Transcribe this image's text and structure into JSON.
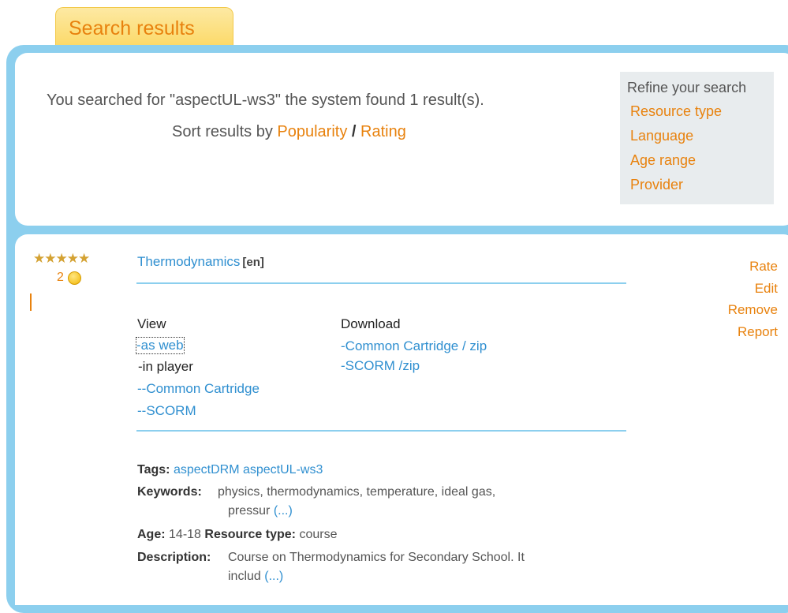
{
  "tab": {
    "label": "Search results"
  },
  "search": {
    "summary": "You searched for \"aspectUL-ws3\" the system found 1 result(s).",
    "sort_prefix": "Sort results by",
    "sort_popularity": "Popularity",
    "sort_separator": "/",
    "sort_rating": "Rating"
  },
  "refine": {
    "title": "Refine your search",
    "items": [
      "Resource type",
      "Language",
      "Age range",
      "Provider"
    ]
  },
  "result": {
    "rating_value": 5,
    "rating_count": "2",
    "title": "Thermodynamics",
    "lang": "[en]",
    "actions": [
      "Rate",
      "Edit",
      "Remove",
      "Report"
    ],
    "view": {
      "header": "View",
      "as_web": "-as web",
      "in_player": "-in player",
      "common_cartridge": "--Common Cartridge",
      "scorm": "--SCORM"
    },
    "download": {
      "header": "Download",
      "cc_zip": "-Common Cartridge / zip",
      "scorm_zip": "-SCORM /zip"
    },
    "tags_label": "Tags:",
    "tags": [
      "aspectDRM",
      "aspectUL-ws3"
    ],
    "keywords_label": "Keywords:",
    "keywords_line1": "physics,   thermodynamics,   temperature,   ideal   gas,",
    "keywords_line2": "pressur",
    "more": "(...)",
    "age_label": "Age:",
    "age": "14-18",
    "resource_type_label": "Resource type:",
    "resource_type": "course",
    "description_label": "Description:",
    "description_line1": "Course on Thermodynamics for Secondary School. It",
    "description_line2": "includ"
  },
  "colors": {
    "accent": "#e8820e",
    "link": "#2f8fd0",
    "frame": "#8ccfee",
    "refine_bg": "#e8ecee"
  }
}
